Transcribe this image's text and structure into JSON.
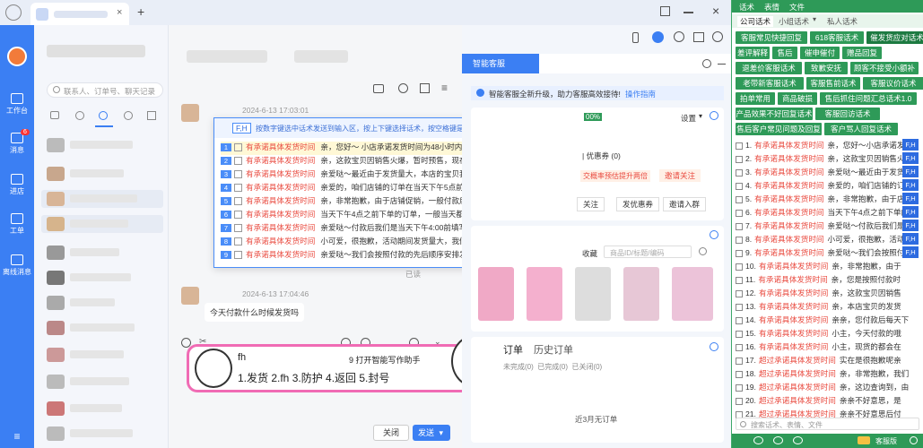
{
  "topbar": {
    "add_tab": "+"
  },
  "rail": {
    "items": [
      {
        "label": "工作台"
      },
      {
        "label": "消息",
        "badge": "6"
      },
      {
        "label": "进店"
      },
      {
        "label": "工单"
      },
      {
        "label": "离线消息"
      }
    ]
  },
  "sessions": {
    "search_placeholder": "联系人、订单号、聊天记录"
  },
  "chat": {
    "time1": "2024-6-13 17:03:01",
    "time2": "2024-6-13 17:04:46",
    "msg_question": "今天付款什么时候发货吗",
    "read_label": "已读",
    "input_text": "fh",
    "close_btn": "关闭",
    "send_btn": "发送"
  },
  "popup": {
    "shortcut": "F,H",
    "hint": "按数字键选中话术发送到输入区，按上下键选择话术，按空格键是发送到输入区，按Enter键是直接发送",
    "items": [
      {
        "num": "1",
        "tag": "有承诺具体发货时间",
        "text": "亲，您好～ 小店承诺发货时间为48小时内发货，根据拍下时间依次发货的，如..."
      },
      {
        "num": "2",
        "tag": "有承诺具体发货时间",
        "text": "亲，这款宝贝因销售火爆，暂时预售，现在付款在X月X日发货，您可以接受吗?"
      },
      {
        "num": "3",
        "tag": "有承诺具体发货时间",
        "text": "亲爱哒～最近由于发货量大，本店的宝贝我们都会尽量在48小时内寄出，如果..."
      },
      {
        "num": "4",
        "tag": "有承诺具体发货时间",
        "text": "亲爱的，咱们店铺的订单在当天下午5点前拍下的都会在当天晚上9点前发出的哦"
      },
      {
        "num": "5",
        "tag": "有承诺具体发货时间",
        "text": "亲，非常抱歉，由于店铺促销，一般付款后24小时内发货，(特价款按预售时间发"
      },
      {
        "num": "6",
        "tag": "有承诺具体发货时间",
        "text": "当天下午4点之前下单的订单，一般当天都可以发出哦～请亲耐心等待一下哦～"
      },
      {
        "num": "7",
        "tag": "有承诺具体发货时间",
        "text": "亲爱哒～付款后我们是当天下午4:00前填写快递单，然后按照先后顺序发货，所..."
      },
      {
        "num": "8",
        "tag": "有承诺具体发货时间",
        "text": "小可爱，很抱歉，活动期间发货量大，我们会尽快在**时间内发货，请您耐心..."
      },
      {
        "num": "9",
        "tag": "有承诺具体发货时间",
        "text": "亲爱哒～我们会按照付款的先后顺序安排发货，一般48小时都可发出，如遇大..."
      }
    ]
  },
  "banner": {
    "title": "9 打开智能写作助手",
    "shortcuts": "1.发货 2.fh 3.防护 4.返回 5.封号",
    "input": "fh"
  },
  "assist": {
    "tab": "智能客服",
    "notice": "智能客服全新升级，助力客服高效接待!",
    "notice_link": "操作指南",
    "settings": "设置",
    "coupon": "| 优惠券 (0)",
    "percent": "00%",
    "promo1": "交概率预估提升两倍",
    "promo2": "邀请关注",
    "btn_follow": "关注",
    "btn_coupon": "发优惠券",
    "btn_group": "邀请入群",
    "fav_label": "收藏",
    "goods_search_placeholder": "商品ID/标题/编码",
    "order_tab_current": "订单",
    "order_tab_history": "历史订单",
    "order_filters": "未完成(0)  已完成(0)  已关闭(0)",
    "order_empty": "近3月无订单"
  },
  "phrases": {
    "tabs": [
      "话术",
      "表情",
      "文件"
    ],
    "subtabs": [
      "公司话术",
      "小组话术",
      "私人话术"
    ],
    "group_buttons": [
      [
        "客服常见快捷回复",
        "618客服话术",
        "催发货应对话术"
      ],
      [
        "差评解释",
        "售后",
        "催申催付",
        "赠品回复"
      ],
      [
        "退差价客服话术",
        "致歉安抚",
        "顾客不接受小额补偿"
      ],
      [
        "老带新客服话术",
        "客服售前话术",
        "客服议价话术"
      ],
      [
        "拍单常用",
        "商品破损",
        "售后抓住问题汇总话术1.0"
      ],
      [
        "产品效果不好回复话术",
        "客服回访话术"
      ],
      [
        "售后客户常见问题及回复",
        "客户骂人回复话术"
      ]
    ],
    "list": [
      {
        "num": "1.",
        "tag": "有承诺具体发货时间",
        "text": "亲，您好～小店承诺发货"
      },
      {
        "num": "2.",
        "tag": "有承诺具体发货时间",
        "text": "亲，这款宝贝因销售火爆"
      },
      {
        "num": "3.",
        "tag": "有承诺具体发货时间",
        "text": "亲爱哒～最近由于发货量"
      },
      {
        "num": "4.",
        "tag": "有承诺具体发货时间",
        "text": "亲爱的，咱们店铺的订单"
      },
      {
        "num": "5.",
        "tag": "有承诺具体发货时间",
        "text": "亲，非常抱歉，由于店铺"
      },
      {
        "num": "6.",
        "tag": "有承诺具体发货时间",
        "text": "当天下午4点之前下单的"
      },
      {
        "num": "7.",
        "tag": "有承诺具体发货时间",
        "text": "亲爱哒～付款后我们是当"
      },
      {
        "num": "8.",
        "tag": "有承诺具体发货时间",
        "text": "小可爱，很抱歉，活动期"
      },
      {
        "num": "9.",
        "tag": "有承诺具体发货时间",
        "text": "亲爱哒～我们会按照付款"
      },
      {
        "num": "10.",
        "tag": "有承诺具体发货时间",
        "text": "亲，非常抱歉，由于"
      },
      {
        "num": "11.",
        "tag": "有承诺具体发货时间",
        "text": "亲，您是按照付款时"
      },
      {
        "num": "12.",
        "tag": "有承诺具体发货时间",
        "text": "亲，这款宝贝因销售"
      },
      {
        "num": "13.",
        "tag": "有承诺具体发货时间",
        "text": "亲，本店宝贝的发货"
      },
      {
        "num": "14.",
        "tag": "有承诺具体发货时间",
        "text": "亲亲，您付款后每天下"
      },
      {
        "num": "15.",
        "tag": "有承诺具体发货时间",
        "text": "小主，今天付款的哦"
      },
      {
        "num": "16.",
        "tag": "有承诺具体发货时间",
        "text": "小主，现货的都会在"
      },
      {
        "num": "17.",
        "tag": "超过承诺具体发货时间",
        "text": "实在是很抱歉呢亲"
      },
      {
        "num": "18.",
        "tag": "超过承诺具体发货时间",
        "text": "亲，非常抱歉，我们"
      },
      {
        "num": "19.",
        "tag": "超过承诺具体发货时间",
        "text": "亲，这边查询到，由"
      },
      {
        "num": "20.",
        "tag": "超过承诺具体发货时间",
        "text": "亲亲不好意思，是"
      },
      {
        "num": "21.",
        "tag": "超过承诺具体发货时间",
        "text": "亲亲不好意思后付"
      }
    ],
    "fh_label": "F,H",
    "search_placeholder": "搜索话术、表情、文件",
    "footer_btn": "客服版"
  }
}
